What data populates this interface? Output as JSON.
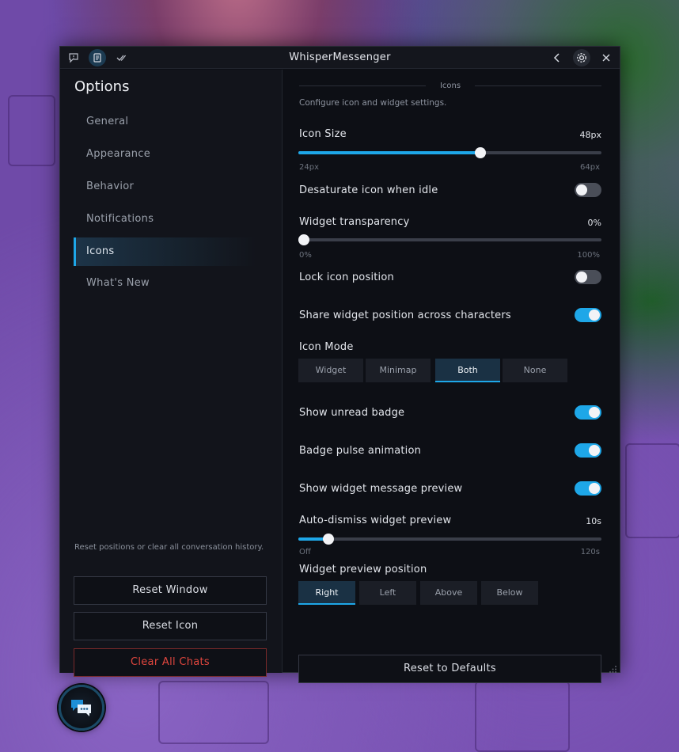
{
  "window": {
    "title": "WhisperMessenger"
  },
  "sidebar": {
    "title": "Options",
    "items": [
      {
        "label": "General",
        "active": false
      },
      {
        "label": "Appearance",
        "active": false
      },
      {
        "label": "Behavior",
        "active": false
      },
      {
        "label": "Notifications",
        "active": false
      },
      {
        "label": "Icons",
        "active": true
      },
      {
        "label": "What's New",
        "active": false
      }
    ],
    "note": "Reset positions or clear all conversation history.",
    "buttons": {
      "reset_window": "Reset Window",
      "reset_icon": "Reset Icon",
      "clear_all": "Clear All Chats"
    }
  },
  "content": {
    "section": "Icons",
    "description": "Configure icon and widget settings.",
    "icon_size": {
      "label": "Icon Size",
      "value": "48px",
      "min": "24px",
      "max": "64px",
      "fraction": 0.6
    },
    "desaturate": {
      "label": "Desaturate icon when idle",
      "on": false
    },
    "transparency": {
      "label": "Widget transparency",
      "value": "0%",
      "min": "0%",
      "max": "100%",
      "fraction": 0.0
    },
    "lock_icon": {
      "label": "Lock icon position",
      "on": false
    },
    "share_widget": {
      "label": "Share widget position across characters",
      "on": true
    },
    "icon_mode": {
      "label": "Icon Mode",
      "options": [
        "Widget",
        "Minimap",
        "Both",
        "None"
      ],
      "selected": "Both"
    },
    "unread_badge": {
      "label": "Show unread badge",
      "on": true
    },
    "badge_pulse": {
      "label": "Badge pulse animation",
      "on": true
    },
    "message_preview": {
      "label": "Show widget message preview",
      "on": true
    },
    "auto_dismiss": {
      "label": "Auto-dismiss widget preview",
      "value": "10s",
      "min": "Off",
      "max": "120s",
      "fraction": 0.1
    },
    "preview_position": {
      "label": "Widget preview position",
      "options": [
        "Right",
        "Left",
        "Above",
        "Below"
      ],
      "selected": "Right"
    },
    "reset_defaults": "Reset to Defaults"
  },
  "colors": {
    "accent": "#1ea7e8",
    "danger": "#e0463e",
    "background": "#0d0f15"
  }
}
